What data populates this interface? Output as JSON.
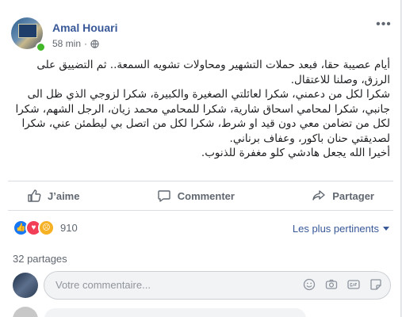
{
  "post": {
    "author": "Amal Houari",
    "time": "58 min",
    "more_label": "•••",
    "paragraphs": [
      "أيام عصيبة حقا، فبعد حملات التشهير ومحاولات تشويه السمعة.. ثم التضييق على الرزق، وصلنا للاعتقال.",
      "شكرا لكل من دعمني، شكرا لعائلتي الصغيرة والكبيرة، شكرا لزوجي الذي ظل الى جانبي، شكرا لمحامي اسحاق شارية، شكرا للمحامي محمد زيان، الرجل الشهم، شكرا لكل من تضامن معي دون قيد او شرط، شكرا لكل من اتصل بي ليطمئن عني، شكرا لصديقتي حنان باكور، وعفاف برناني.",
      "أخيرا الله يجعل هادشي كلو مغفرة للذنوب."
    ]
  },
  "actions": {
    "like": "J’aime",
    "comment": "Commenter",
    "share": "Partager"
  },
  "reactions": {
    "count": "910",
    "sort_label": "Les plus pertinents"
  },
  "shares_label": "32 partages",
  "comment_input": {
    "placeholder": "Votre commentaire..."
  },
  "icons": [
    "globe-icon",
    "more-icon",
    "like-icon",
    "comment-icon",
    "share-icon",
    "emoji-icon",
    "camera-icon",
    "gif-icon",
    "sticker-icon"
  ],
  "colors": {
    "link": "#385898",
    "like": "#1877f2",
    "love": "#f33e58",
    "sad": "#f7b125",
    "online": "#42b72a"
  }
}
